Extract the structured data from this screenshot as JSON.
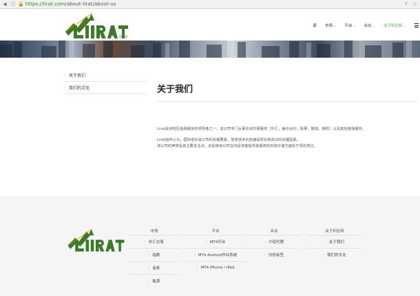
{
  "browser": {
    "url_host": "https://lirat.com",
    "url_path": "/about-lirat/about-us"
  },
  "nav": {
    "items": [
      {
        "label": "家",
        "dropdown": false
      },
      {
        "label": "市场",
        "dropdown": true
      },
      {
        "label": "平台",
        "dropdown": true
      },
      {
        "label": "合伙",
        "dropdown": true
      },
      {
        "label": "关于利拉特",
        "dropdown": true,
        "active": true
      }
    ]
  },
  "sidebar": {
    "items": [
      {
        "label": "关于我们"
      },
      {
        "label": "我们的文化"
      }
    ]
  },
  "main": {
    "title": "关于我们",
    "paragraphs": [
      "Lirat是该地区金融服务的领导者之一。该公司专门从事在线交易服务（外汇，差价合约，股票，期货，期权）以及其他金融服务。",
      "Lirat始终认为，国际增长是公司的关键要素。信息技术的加速是增长和成功的关键因素。",
      "该公司的声誉是其主要关注点，这促使该公司在向投资者提供其服务的实际价值方面处于领先地位。"
    ]
  },
  "footer": {
    "columns": [
      {
        "head": "市场",
        "links": [
          "外汇交易",
          "指数",
          "金条",
          "能源"
        ]
      },
      {
        "head": "平台",
        "links": [
          "MT4平台",
          "MT4 Android作业系统",
          "MT4 iPhone / iPad"
        ]
      },
      {
        "head": "合伙",
        "links": [
          "介绍代理",
          "白色标签"
        ]
      },
      {
        "head": "关于利拉特",
        "links": [
          "关于我们",
          "我们的文化"
        ]
      }
    ]
  },
  "colors": {
    "brand_green": "#4caf50",
    "logo_green": "#3d7a2a",
    "logo_gold": "#b89a2f"
  }
}
